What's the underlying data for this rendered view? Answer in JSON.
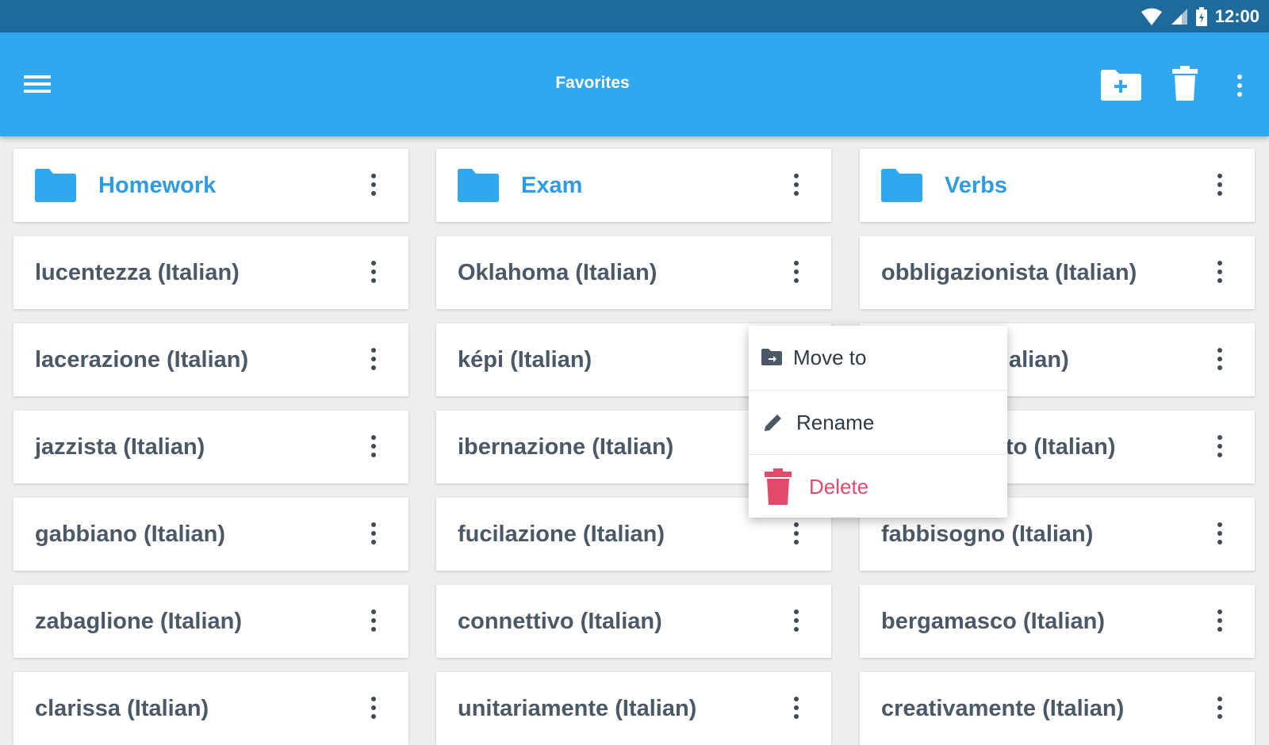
{
  "status_bar": {
    "time": "12:00"
  },
  "app_bar": {
    "title": "Favorites"
  },
  "folders": [
    {
      "label": "Homework"
    },
    {
      "label": "Exam"
    },
    {
      "label": "Verbs"
    }
  ],
  "words": {
    "col1": [
      "lucentezza (Italian)",
      "lacerazione (Italian)",
      "jazzista (Italian)",
      "gabbiano (Italian)",
      "zabaglione (Italian)",
      "clarissa (Italian)"
    ],
    "col2": [
      "Oklahoma (Italian)",
      "képi (Italian)",
      "ibernazione (Italian)",
      "fucilazione (Italian)",
      "connettivo (Italian)",
      "unitariamente (Italian)"
    ],
    "col3": [
      "obbligazionista (Italian)",
      "alian)",
      "to (Italian)",
      "fabbisogno (Italian)",
      "bergamasco (Italian)",
      "creativamente (Italian)"
    ]
  },
  "context_menu": {
    "items": [
      {
        "label": "Move to",
        "icon": "folder-move-icon"
      },
      {
        "label": "Rename",
        "icon": "pencil-icon"
      },
      {
        "label": "Delete",
        "icon": "trash-icon"
      }
    ]
  },
  "colors": {
    "status_bar": "#1e6a9a",
    "app_bar": "#2fa8f0",
    "folder_accent": "#2f9be0",
    "delete_accent": "#e24a6b"
  }
}
